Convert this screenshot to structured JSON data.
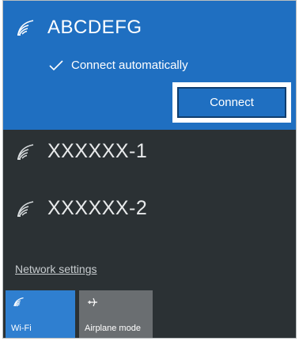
{
  "selected_network": {
    "name": "ABCDEFG",
    "connect_automatically_label": "Connect automatically",
    "connect_button_label": "Connect"
  },
  "networks": [
    {
      "name": "XXXXXX-1"
    },
    {
      "name": "XXXXXX-2"
    }
  ],
  "network_settings_label": "Network settings",
  "quick_actions": [
    {
      "label": "Wi-Fi",
      "icon": "wifi-icon",
      "active": true
    },
    {
      "label": "Airplane mode",
      "icon": "airplane-icon",
      "active": false
    }
  ],
  "colors": {
    "accent": "#1f6fc1",
    "panel_background": "#2b3134",
    "inactive_tile": "#6a6e71"
  }
}
